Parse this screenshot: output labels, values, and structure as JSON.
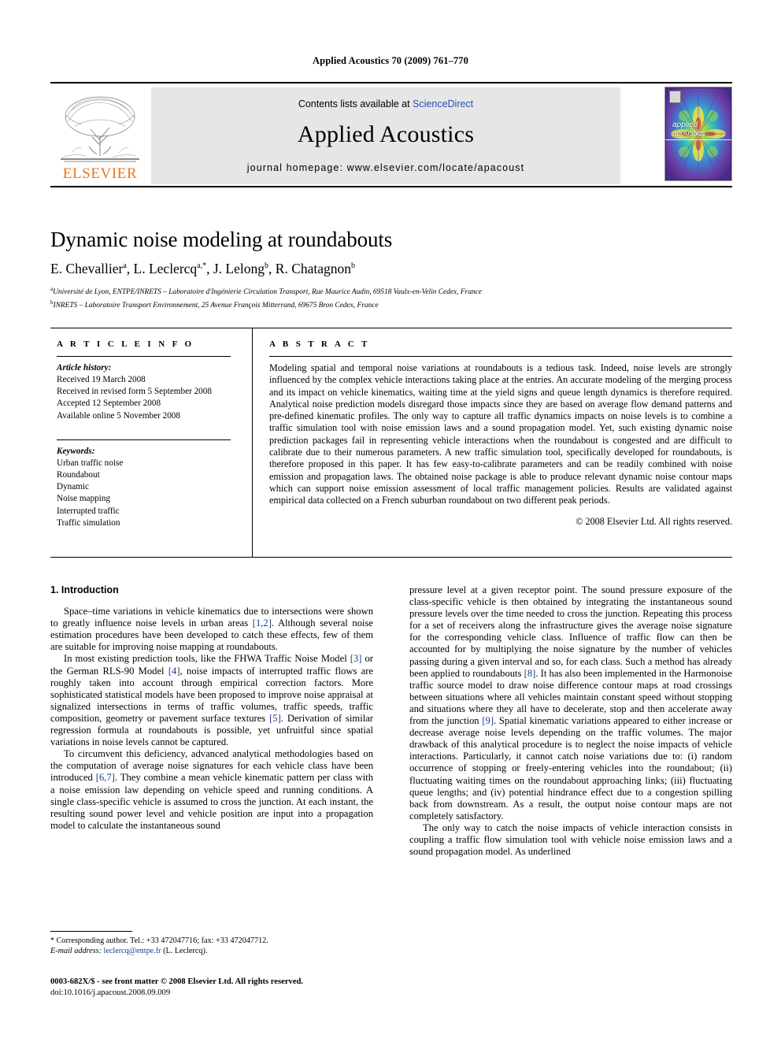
{
  "running_head": "Applied Acoustics 70 (2009) 761–770",
  "masthead": {
    "contents_prefix": "Contents lists available at ",
    "sciencedirect": "ScienceDirect",
    "journal_title": "Applied Acoustics",
    "homepage": "journal homepage: www.elsevier.com/locate/apacoust",
    "publisher": "ELSEVIER",
    "publisher_accent_color": "#E87722",
    "cover_title_line1": "applied",
    "cover_title_line2": "acoustics"
  },
  "article": {
    "title": "Dynamic noise modeling at roundabouts",
    "authors": "E. Chevallier a, L. Leclercq a,*, J. Lelong b, R. Chatagnon b",
    "affiliation_a": "Université de Lyon, ENTPE/INRETS – Laboratoire d'Ingénierie Circulation Transport, Rue Maurice Audin, 69518 Vaulx-en-Velin Cedex, France",
    "affiliation_b": "INRETS – Laboratoire Transport Environnement, 25 Avenue François Mitterrand, 69675 Bron Cedex, France"
  },
  "info": {
    "heading": "A R T I C L E   I N F O",
    "history_label": "Article history:",
    "history": [
      "Received 19 March 2008",
      "Received in revised form 5 September 2008",
      "Accepted 12 September 2008",
      "Available online 5 November 2008"
    ],
    "keywords_label": "Keywords:",
    "keywords": [
      "Urban traffic noise",
      "Roundabout",
      "Dynamic",
      "Noise mapping",
      "Interrupted traffic",
      "Traffic simulation"
    ]
  },
  "abstract": {
    "heading": "A B S T R A C T",
    "text": "Modeling spatial and temporal noise variations at roundabouts is a tedious task. Indeed, noise levels are strongly influenced by the complex vehicle interactions taking place at the entries. An accurate modeling of the merging process and its impact on vehicle kinematics, waiting time at the yield signs and queue length dynamics is therefore required. Analytical noise prediction models disregard those impacts since they are based on average flow demand patterns and pre-defined kinematic profiles. The only way to capture all traffic dynamics impacts on noise levels is to combine a traffic simulation tool with noise emission laws and a sound propagation model. Yet, such existing dynamic noise prediction packages fail in representing vehicle interactions when the roundabout is congested and are difficult to calibrate due to their numerous parameters. A new traffic simulation tool, specifically developed for roundabouts, is therefore proposed in this paper. It has few easy-to-calibrate parameters and can be readily combined with noise emission and propagation laws. The obtained noise package is able to produce relevant dynamic noise contour maps which can support noise emission assessment of local traffic management policies. Results are validated against empirical data collected on a French suburban roundabout on two different peak periods.",
    "copyright": "© 2008 Elsevier Ltd. All rights reserved."
  },
  "body": {
    "section_heading": "1. Introduction",
    "left_paragraphs": [
      "Space–time variations in vehicle kinematics due to intersections were shown to greatly influence noise levels in urban areas [1,2]. Although several noise estimation procedures have been developed to catch these effects, few of them are suitable for improving noise mapping at roundabouts.",
      "In most existing prediction tools, like the FHWA Traffic Noise Model [3] or the German RLS-90 Model [4], noise impacts of interrupted traffic flows are roughly taken into account through empirical correction factors. More sophisticated statistical models have been proposed to improve noise appraisal at signalized intersections in terms of traffic volumes, traffic speeds, traffic composition, geometry or pavement surface textures [5]. Derivation of similar regression formula at roundabouts is possible, yet unfruitful since spatial variations in noise levels cannot be captured.",
      "To circumvent this deficiency, advanced analytical methodologies based on the computation of average noise signatures for each vehicle class have been introduced [6,7]. They combine a mean vehicle kinematic pattern per class with a noise emission law depending on vehicle speed and running conditions. A single class-specific vehicle is assumed to cross the junction. At each instant, the resulting sound power level and vehicle position are input into a propagation model to calculate the instantaneous sound"
    ],
    "right_paragraphs": [
      "pressure level at a given receptor point. The sound pressure exposure of the class-specific vehicle is then obtained by integrating the instantaneous sound pressure levels over the time needed to cross the junction. Repeating this process for a set of receivers along the infrastructure gives the average noise signature for the corresponding vehicle class. Influence of traffic flow can then be accounted for by multiplying the noise signature by the number of vehicles passing during a given interval and so, for each class. Such a method has already been applied to roundabouts [8]. It has also been implemented in the Harmonoise traffic source model to draw noise difference contour maps at road crossings between situations where all vehicles maintain constant speed without stopping and situations where they all have to decelerate, stop and then accelerate away from the junction [9]. Spatial kinematic variations appeared to either increase or decrease average noise levels depending on the traffic volumes. The major drawback of this analytical procedure is to neglect the noise impacts of vehicle interactions. Particularly, it cannot catch noise variations due to: (i) random occurrence of stopping or freely-entering vehicles into the roundabout; (ii) fluctuating waiting times on the roundabout approaching links; (iii) fluctuating queue lengths; and (iv) potential hindrance effect due to a congestion spilling back from downstream. As a result, the output noise contour maps are not completely satisfactory.",
      "The only way to catch the noise impacts of vehicle interaction consists in coupling a traffic flow simulation tool with vehicle noise emission laws and a sound propagation model. As underlined"
    ],
    "reference_color": "#1b3a8f"
  },
  "footnote": {
    "corresponding": "* Corresponding author. Tel.: +33 472047716; fax: +33 472047712.",
    "email_label": "E-mail address:",
    "email": "leclercq@entpe.fr",
    "email_suffix": "(L. Leclercq)."
  },
  "issn": {
    "line1": "0003-682X/$ - see front matter © 2008 Elsevier Ltd. All rights reserved.",
    "line2": "doi:10.1016/j.apacoust.2008.09.009"
  }
}
